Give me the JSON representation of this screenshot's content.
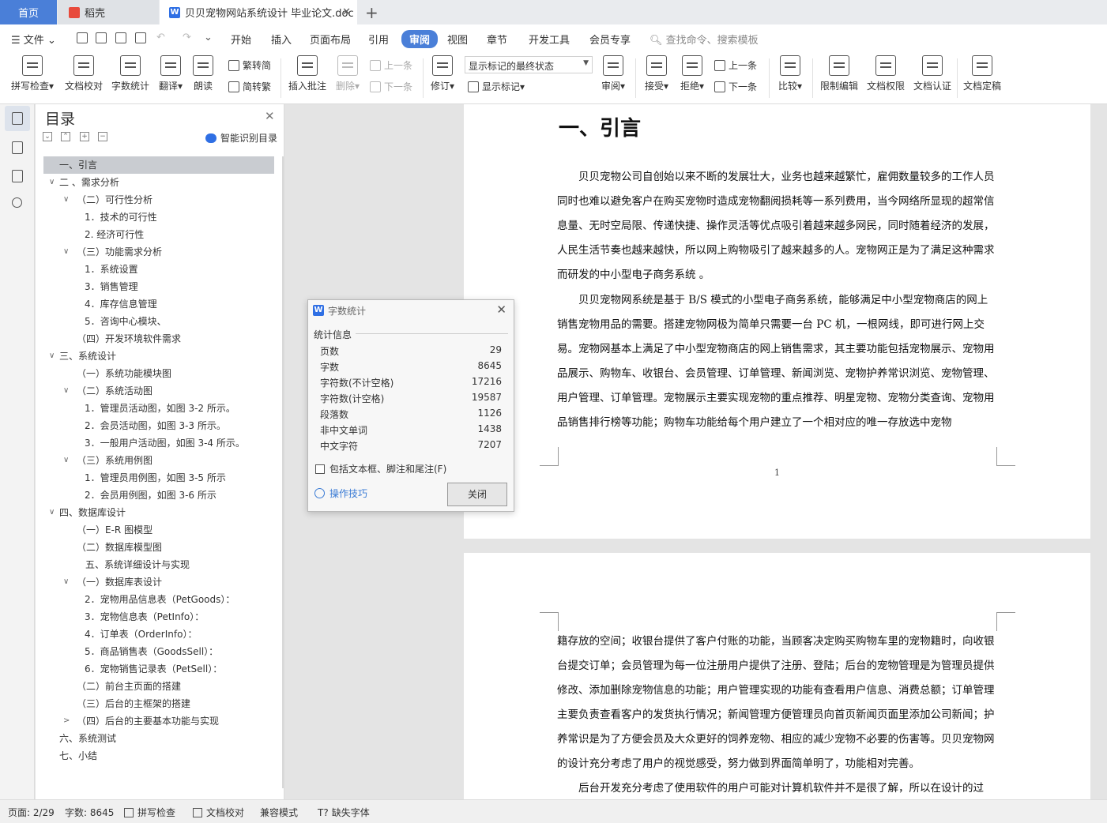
{
  "tabs": {
    "home": "首页",
    "docer": "稻壳",
    "doc": "贝贝宠物网站系统设计 毕业论文.doc",
    "doc_close": "✕",
    "add": "+"
  },
  "menu": {
    "file": "文件",
    "items": [
      "开始",
      "插入",
      "页面布局",
      "引用",
      "审阅",
      "视图",
      "章节",
      "开发工具",
      "会员专享"
    ],
    "active_index": 4,
    "search": "查找命令、搜索模板"
  },
  "ribbon": {
    "spell": "拼写检查",
    "proof": "文档校对",
    "wordcount": "字数统计",
    "translate": "翻译",
    "read": "朗读",
    "trad": "繁转简",
    "simp": "简转繁",
    "insert_comment": "插入批注",
    "delete": "删除",
    "prev": "上一条",
    "next": "下一条",
    "track": "修订",
    "mode_value": "显示标记的最终状态",
    "show_marks": "显示标记",
    "review": "审阅",
    "accept": "接受",
    "reject": "拒绝",
    "prev2": "上一条",
    "next2": "下一条",
    "compare": "比较",
    "restrict": "限制编辑",
    "permission": "文档权限",
    "certify": "文档认证",
    "finalize": "文档定稿"
  },
  "toc": {
    "title": "目录",
    "smart": "智能识别目录",
    "close": "✕",
    "items": [
      {
        "text": "一、引言",
        "chev": "",
        "active": true
      },
      {
        "text": "二 、需求分析",
        "chev": "∨"
      },
      {
        "text": "（二）可行性分析",
        "chev": "∨"
      },
      {
        "text": "1．技术的可行性",
        "chev": ""
      },
      {
        "text": "2.   经济可行性",
        "chev": ""
      },
      {
        "text": "（三）功能需求分析",
        "chev": "∨"
      },
      {
        "text": "1．系统设置",
        "chev": ""
      },
      {
        "text": "3．销售管理",
        "chev": ""
      },
      {
        "text": "4．库存信息管理",
        "chev": ""
      },
      {
        "text": "5．咨询中心模块、",
        "chev": ""
      },
      {
        "text": "（四）开发环境软件需求",
        "chev": ""
      },
      {
        "text": "三、系统设计",
        "chev": "∨"
      },
      {
        "text": "（一）系统功能模块图",
        "chev": ""
      },
      {
        "text": "（二）系统活动图",
        "chev": "∨"
      },
      {
        "text": "1．管理员活动图，如图 3-2 所示。",
        "chev": ""
      },
      {
        "text": "2．会员活动图，如图 3-3 所示。",
        "chev": ""
      },
      {
        "text": "3．一般用户活动图，如图 3-4 所示。",
        "chev": ""
      },
      {
        "text": "（三）系统用例图",
        "chev": "∨"
      },
      {
        "text": "1．管理员用例图，如图 3-5 所示",
        "chev": ""
      },
      {
        "text": "2．会员用例图，如图 3-6 所示",
        "chev": ""
      },
      {
        "text": "四、数据库设计",
        "chev": "∨"
      },
      {
        "text": "（一）E-R 图模型",
        "chev": ""
      },
      {
        "text": "（二）数据库模型图",
        "chev": ""
      },
      {
        "text": "五、系统详细设计与实现",
        "chev": ""
      },
      {
        "text": "（一）数据库表设计",
        "chev": "∨"
      },
      {
        "text": "2．宠物用品信息表（PetGoods）：",
        "chev": ""
      },
      {
        "text": "3．宠物信息表（PetInfo）：",
        "chev": ""
      },
      {
        "text": "4．订单表（OrderInfo）：",
        "chev": ""
      },
      {
        "text": "5．商品销售表（GoodsSell）：",
        "chev": ""
      },
      {
        "text": "6．宠物销售记录表（PetSell）：",
        "chev": ""
      },
      {
        "text": "（二）前台主页面的搭建",
        "chev": ""
      },
      {
        "text": "（三）后台的主框架的搭建",
        "chev": ""
      },
      {
        "text": "（四）后台的主要基本功能与实现",
        "chev": ">"
      },
      {
        "text": "六、系统测试",
        "chev": ""
      },
      {
        "text": "七、小结",
        "chev": ""
      }
    ]
  },
  "document": {
    "heading": "一、引言",
    "p1": "贝贝宠物公司自创始以来不断的发展壮大，业务也越来越繁忙，雇佣数量较多的工作人员同时也难以避免客户在购买宠物时造成宠物翻阅损耗等一系列费用，当今网络所显现的超常信息量、无时空局限、传递快捷、操作灵活等优点吸引着越来越多网民，同时随着经济的发展，人民生活节奏也越来越快，所以网上购物吸引了越来越多的人。宠物网正是为了满足这种需求而研发的中小型电子商务系统 。",
    "p2": "贝贝宠物网系统是基于 B/S 模式的小型电子商务系统，能够满足中小型宠物商店的网上销售宠物用品的需要。搭建宠物网极为简单只需要一台 PC 机，一根网线，即可进行网上交易。宠物网基本上满足了中小型宠物商店的网上销售需求，其主要功能包括宠物展示、宠物用品展示、购物车、收银台、会员管理、订单管理、新闻浏览、宠物护养常识浏览、宠物管理、用户管理、订单管理。宠物展示主要实现宠物的重点推荐、明星宠物、宠物分类查询、宠物用品销售排行榜等功能；购物车功能给每个用户建立了一个相对应的唯一存放选中宠物",
    "page_number": "1",
    "p3": "籍存放的空间；收银台提供了客户付账的功能，当顾客决定购买购物车里的宠物籍时，向收银台提交订单；会员管理为每一位注册用户提供了注册、登陆；后台的宠物管理是为管理员提供修改、添加删除宠物信息的功能；用户管理实现的功能有查看用户信息、消费总额；订单管理主要负责查看客户的发货执行情况；新闻管理方便管理员向首页新闻页面里添加公司新闻；护养常识是为了方便会员及大众更好的饲养宠物、相应的减少宠物不必要的伤害等。贝贝宠物网的设计充分考虑了用户的视觉感受，努力做到界面简单明了，功能相对完善。",
    "p4": "后台开发充分考虑了使用软件的用户可能对计算机软件并不是很了解，所以在设计的过"
  },
  "dialog": {
    "title": "字数统计",
    "section": "统计信息",
    "rows": [
      {
        "k": "页数",
        "v": "29"
      },
      {
        "k": "字数",
        "v": "8645"
      },
      {
        "k": "字符数(不计空格)",
        "v": "17216"
      },
      {
        "k": "字符数(计空格)",
        "v": "19587"
      },
      {
        "k": "段落数",
        "v": "1126"
      },
      {
        "k": "非中文单词",
        "v": "1438"
      },
      {
        "k": "中文字符",
        "v": "7207"
      }
    ],
    "checkbox": "包括文本框、脚注和尾注(F)",
    "tips": "操作技巧",
    "close": "关闭"
  },
  "status": {
    "page": "页面: 2/29",
    "words": "字数: 8645",
    "spell": "拼写检查",
    "proof": "文档校对",
    "compat": "兼容模式",
    "missing_font": "缺失字体"
  },
  "colors": {
    "accent": "#4a7fd8",
    "brand_w": "#2f6fe4",
    "docer": "#e84a3c"
  }
}
